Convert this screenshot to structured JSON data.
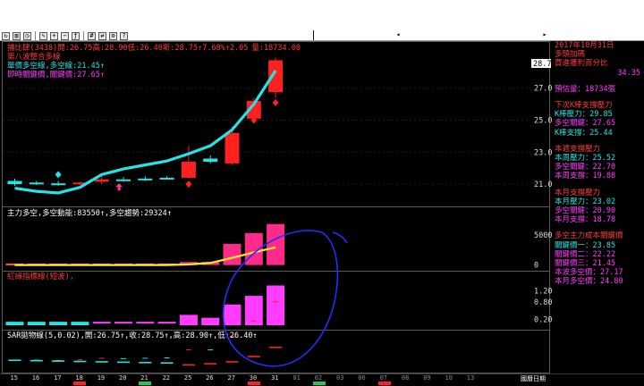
{
  "colors": {
    "background": "#000000",
    "up": "#ff2020",
    "down": "#22e5e5",
    "magenta": "#ff3cff",
    "orange": "#ff5a2a",
    "yellow": "#ffee22",
    "pink": "#ff3399",
    "axis": "#dddddd",
    "annotation": "#2a2aff"
  },
  "toolbar": {
    "icons": [
      "refresh-icon",
      "chart-type-icon",
      "period-icon",
      "draw-icon",
      "zoom-in-icon",
      "zoom-out-icon",
      "indicator-icon",
      "grid-icon",
      "compare-icon",
      "settings-icon",
      "help-icon"
    ],
    "scroll_left": "◂",
    "scroll_right": "▸"
  },
  "price_panel": {
    "header": {
      "stock": "捕比肆(3438)",
      "open": "開:26.75",
      "high": "高:28.90",
      "low": "低:26.40",
      "new": "新:28.75",
      "change": "↑7.68%",
      "change2": "↑2.05",
      "volume": "量:18734.00"
    },
    "legend1": "第八波整合多線",
    "legend2": "單價多空線,多空線:21.45↑",
    "legend3": "即時關鍵價,關鍵價:27.65↑",
    "axis_labels": [
      "27.00",
      "25.00",
      "23.00",
      "21.00"
    ],
    "current_price": "28.75"
  },
  "main_force_panel": {
    "title": "主力多空,多空動能:83550↑,多空趨勢:29324↑",
    "axis_labels": [
      "50000",
      "0"
    ]
  },
  "red_green_panel": {
    "title": "紅綠指標線(短波),",
    "axis_labels": [
      "1.200",
      "0.800",
      "0.200"
    ]
  },
  "sar_panel": {
    "title": "SAR拋物線(5,0.02),開:26.75↑,收:28.75↑,高:28.90↑,低:26.40↑"
  },
  "x_axis": {
    "dates": [
      "15",
      "16",
      "17",
      "18",
      "19",
      "20",
      "21",
      "22",
      "25",
      "26",
      "27",
      "30",
      "31",
      "01",
      "02",
      "03",
      "06",
      "07",
      "08",
      "09",
      "10",
      "13"
    ],
    "right_label": "國曆日期"
  },
  "right_panel": {
    "date": "2017年10月31日",
    "line2": "多頭加碼",
    "line3": "買進獲利百分比",
    "profit_pct": "34.35",
    "volume_est": "預估量：18734張",
    "k_title": "下次K棒支撐壓力",
    "k_lines": [
      "K棒壓力：29.85",
      "多空關鍵：27.65",
      "K棒支撐：25.44"
    ],
    "week_title": "本週支撐壓力",
    "week_lines": [
      "本周壓力：25.52",
      "多空關鍵：22.70",
      "本周支撐：19.88"
    ],
    "month_title": "本月支撐壓力",
    "month_lines": [
      "本月壓力：23.02",
      "多空關鍵：20.90",
      "本月支撐：18.78"
    ],
    "force_title": "多空主力成本關鍵價",
    "force_lines": [
      "關鍵價一：23.85",
      "關鍵價二：22.22",
      "關鍵價三：21.45",
      "本波多空價：27.17",
      "本月多空價：24.80"
    ]
  },
  "chart_data": {
    "type": "candlestick",
    "dates": [
      "15",
      "16",
      "17",
      "18",
      "19",
      "20",
      "21",
      "22",
      "25",
      "26",
      "27",
      "30",
      "31"
    ],
    "ohlc": [
      [
        21.2,
        21.35,
        20.9,
        21.0,
        "down"
      ],
      [
        21.1,
        21.2,
        20.95,
        21.05,
        "down"
      ],
      [
        21.05,
        21.2,
        20.9,
        21.0,
        "down"
      ],
      [
        21.0,
        21.15,
        20.95,
        21.1,
        "up"
      ],
      [
        21.15,
        21.5,
        21.0,
        21.3,
        "up"
      ],
      [
        21.3,
        21.45,
        21.15,
        21.25,
        "down"
      ],
      [
        21.35,
        21.5,
        21.2,
        21.3,
        "down"
      ],
      [
        21.4,
        21.5,
        21.3,
        21.35,
        "down"
      ],
      [
        21.4,
        23.4,
        21.35,
        22.4,
        "up"
      ],
      [
        22.6,
        22.8,
        22.3,
        22.4,
        "down"
      ],
      [
        22.3,
        24.6,
        22.2,
        24.2,
        "up"
      ],
      [
        25.1,
        26.4,
        24.9,
        26.2,
        "up"
      ],
      [
        26.75,
        28.9,
        26.4,
        28.75,
        "up"
      ]
    ],
    "trend_line": [
      20.75,
      20.55,
      20.45,
      20.8,
      21.6,
      21.95,
      22.2,
      22.45,
      22.9,
      23.4,
      24.4,
      26.0,
      28.1
    ],
    "key_markers": [
      null,
      null,
      21.6,
      null,
      null,
      null,
      null,
      null,
      21.0,
      null,
      22.9,
      25.0,
      26.1
    ],
    "main_force_bars": [
      2500,
      2500,
      2500,
      2500,
      2500,
      2500,
      2500,
      2500,
      5000,
      5000,
      35000,
      53000,
      68000
    ],
    "main_force_trend": [
      0,
      0,
      0,
      0,
      0,
      0,
      0,
      0,
      1000,
      3500,
      12000,
      21000,
      29324
    ],
    "red_green_bars": [
      0.12,
      0.12,
      0.12,
      0.12,
      0.12,
      0.12,
      0.12,
      0.12,
      0.36,
      0.26,
      0.72,
      1.02,
      1.38
    ],
    "red_green_types": [
      "down",
      "down",
      "down",
      "down",
      "flat",
      "flat",
      "flat",
      "flat",
      "up",
      "up",
      "up",
      "up",
      "up"
    ],
    "sar_points": [
      21.5,
      21.45,
      21.4,
      21.35,
      21.3,
      21.25,
      21.2,
      21.15,
      20.9,
      21.05,
      21.3,
      22.0,
      23.2
    ],
    "price_ylim": [
      20.0,
      29.5
    ],
    "main_force_ylim": [
      -5000,
      75000
    ],
    "red_green_ylim": [
      0,
      1.55
    ]
  }
}
